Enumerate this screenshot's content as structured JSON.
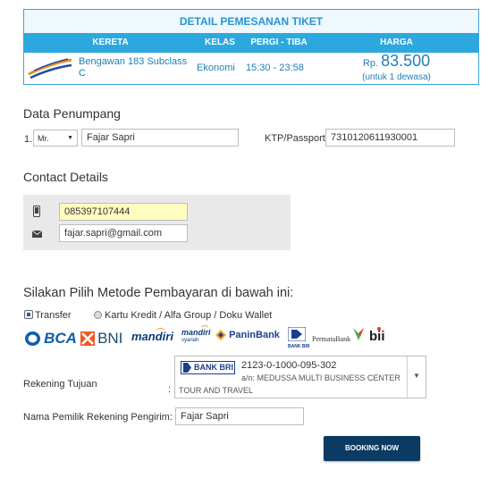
{
  "ticket": {
    "title": "DETAIL PEMESANAN TIKET",
    "headers": {
      "train": "KERETA",
      "class": "KELAS",
      "route": "PERGI - TIBA",
      "price": "HARGA"
    },
    "train_line1": "Bengawan 183 Subclass",
    "train_line2": "C",
    "class": "Ekonomi",
    "time": "15:30 - 23:58",
    "currency": "Rp.",
    "price": "83.500",
    "price_note": "(untuk 1 dewasa)"
  },
  "passenger": {
    "section_title": "Data Penumpang",
    "number": "1.",
    "title_value": "Mr.",
    "name_value": "Fajar Sapri",
    "ktp_label": "KTP/Passport",
    "ktp_value": "7310120611930001"
  },
  "contact": {
    "section_title": "Contact Details",
    "phone_value": "085397107444",
    "email_value": "fajar.sapri@gmail.com"
  },
  "payment": {
    "section_title": "Silakan Pilih Metode Pembayaran di bawah ini:",
    "option_transfer": "Transfer",
    "option_card": "Kartu Kredit / Alfa Group / Doku Wallet",
    "banks": {
      "bca": "BCA",
      "bni": "BNI",
      "mandiri": "mandiri",
      "mandiri_syariah_1": "mandiri",
      "mandiri_syariah_2": "syariah",
      "panin": "PaninBank",
      "bri": "BANK BRI",
      "permata": "PermataBank",
      "bii": "bii"
    },
    "account_label": "Rekening Tujuan",
    "colon": ":",
    "selected_bank_logo": "BANK BRI",
    "account_number": "2123-0-1000-095-302",
    "account_name": "a/n: MEDUSSA MULTI BUSINESS CENTER",
    "account_name_2": "TOUR AND TRAVEL",
    "sender_label": "Nama Pemilik Rekening Pengirim:",
    "sender_value": "Fajar Sapri"
  },
  "booking_button": "BOOKING NOW",
  "colors": {
    "accent_blue": "#2da8df",
    "ticket_text": "#1f7fb6",
    "button_dark": "#0b3b63",
    "phone_highlight": "#fffcc0"
  }
}
